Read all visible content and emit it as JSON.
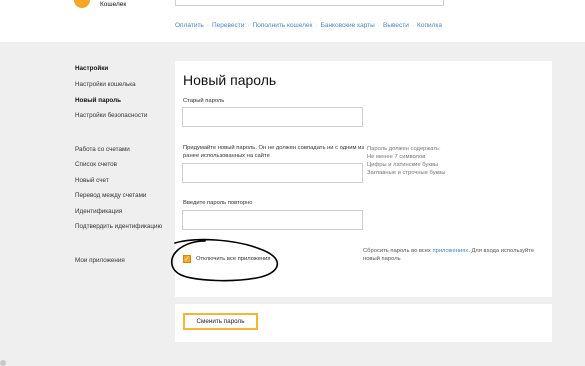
{
  "header": {
    "logo_text": "Кошелек",
    "nav": [
      "Оплатить",
      "Перевести",
      "Пополнить кошелек",
      "Банковские карты",
      "Вывести",
      "Копилка"
    ]
  },
  "sidebar": {
    "items": [
      {
        "label": "Настройки",
        "bold": true
      },
      {
        "label": "Настройки кошелька",
        "bold": false
      },
      {
        "label": "Новый пароль",
        "bold": true
      },
      {
        "label": "Настройки безопасности",
        "bold": false
      },
      {
        "label": "Работа со счетами",
        "bold": false
      },
      {
        "label": "Список счетов",
        "bold": false
      },
      {
        "label": "Новый счет",
        "bold": false
      },
      {
        "label": "Перевод между счетами",
        "bold": false
      },
      {
        "label": "Идентификация",
        "bold": false
      },
      {
        "label": "Подтвердить идентификацию",
        "bold": false
      },
      {
        "label": "Мои приложения",
        "bold": false
      }
    ]
  },
  "form": {
    "title": "Новый пароль",
    "old_password_label": "Старый пароль",
    "new_password_label_line1": "Придумайте новый пароль. Он не должен совпадать ни с одним из",
    "new_password_label_line2": "ранее использованных на сайте",
    "hint": {
      "line1": "Пароль должен содержать:",
      "line2": "Не менее 7 символов",
      "line3": "Цифры и латинские буквы",
      "line4": "Заглавные и строчные буквы"
    },
    "repeat_password_label": "Введите пароль повторно",
    "disable_apps_label": "Отключить все приложения",
    "disable_apps_checked": true,
    "reset_text_before": "Сбросить пароль во всех ",
    "reset_link": "приложениях",
    "reset_text_after": ". Для входа используйте новый пароль",
    "submit_label": "Сменить пароль"
  },
  "colors": {
    "accent": "#f5a623",
    "link": "#4a86c0",
    "background": "#efefef"
  }
}
